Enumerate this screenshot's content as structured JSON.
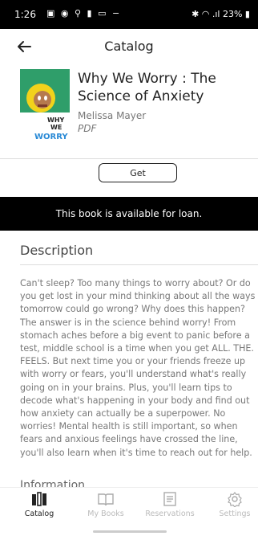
{
  "status": {
    "time": "1:26",
    "battery": "23%"
  },
  "header": {
    "title": "Catalog"
  },
  "book": {
    "title": "Why We Worry : The Science of Anxiety",
    "author": "Melissa Mayer",
    "format": "PDF",
    "cover_text": [
      "WHY",
      "WE",
      "WORRY"
    ]
  },
  "actions": {
    "get_label": "Get"
  },
  "banner": "This book is available for loan.",
  "description": {
    "heading": "Description",
    "text": "Can't sleep? Too many things to worry about? Or do you get lost in your mind thinking about all the ways tomorrow could go wrong? Why does this happen? The answer is in the science behind worry! From stomach aches before a big event to panic before a test, middle school is a time when you get ALL. THE. FEELS. But next time you or your friends freeze up with worry or fears, you'll understand what's really going on in your brains. Plus, you'll learn tips to decode what's happening in your body and find out how anxiety can actually be a superpower. No worries! Mental health is still important, so when fears and anxious feelings have crossed the line, you'll also learn when it's time to reach out for help."
  },
  "info_heading": "Information",
  "nav": [
    {
      "label": "Catalog",
      "icon": "catalog-icon",
      "active": true
    },
    {
      "label": "My Books",
      "icon": "book-icon",
      "active": false
    },
    {
      "label": "Reservations",
      "icon": "reservations-icon",
      "active": false
    },
    {
      "label": "Settings",
      "icon": "gear-icon",
      "active": false
    }
  ]
}
